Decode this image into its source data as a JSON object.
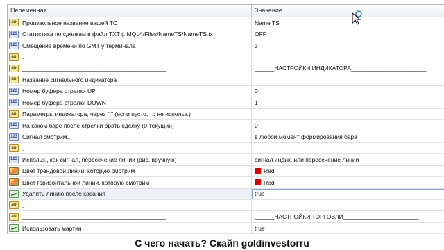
{
  "header": {
    "col_variable": "Переменная",
    "col_value": "Значение"
  },
  "rows": [
    {
      "icon": "ab-string-icon",
      "name": "Произвольное название вашей ТС",
      "value": "Name TS"
    },
    {
      "icon": "number-icon",
      "name": "Статистика по сделкам в файл TXT (..MQL4/Files/NameTS/NameTS.tx",
      "value": "OFF"
    },
    {
      "icon": "number-icon",
      "name": "Смещение времени по GMT у терминала",
      "value": "3"
    },
    {
      "icon": "ab-string-icon",
      "name": ".",
      "value": ""
    },
    {
      "icon": "ab-string-icon",
      "name": "____________________________________________",
      "value": "______НАСТРОЙКИ ИНДИКАТОРА_______________________"
    },
    {
      "icon": "ab-string-icon",
      "name": "Название сигнального индикатора",
      "value": ""
    },
    {
      "icon": "number-icon",
      "name": "Номер буфера стрелки UP",
      "value": "0"
    },
    {
      "icon": "number-icon",
      "name": "Номер буфера стрелки DOWN",
      "value": "1"
    },
    {
      "icon": "ab-string-icon",
      "name": "Параметры индикатора, через \";\" (если пусто, то не использ.)",
      "value": ""
    },
    {
      "icon": "number-icon",
      "name": "На каком баре после стрелки брать сделку (0-текущий)",
      "value": "0"
    },
    {
      "icon": "number-icon",
      "name": "Сигнал смотрим...",
      "value": "в любой момент формирования бара"
    },
    {
      "icon": "ab-string-icon",
      "name": ".",
      "value": ""
    },
    {
      "icon": "number-icon",
      "name": "Использ., как сигнал, пересечение линии (рис. вручную)",
      "value": "сигнал индик. или пересечение линии"
    },
    {
      "icon": "color-icon",
      "name": "Цвет трендовой линии, которую смотрим",
      "value": "Red",
      "swatch": "#e00000"
    },
    {
      "icon": "color-icon",
      "name": "Цвет горизонтальной линии, которую смотрим",
      "value": "Red",
      "swatch": "#e00000"
    },
    {
      "icon": "bool-icon",
      "name": "Удалять линию после касания",
      "value": "true",
      "selected": true
    },
    {
      "icon": "ab-string-icon",
      "name": ".",
      "value": ""
    },
    {
      "icon": "ab-string-icon",
      "name": "____________________________________________",
      "value": "______НАСТРОЙКИ ТОРГОВЛИ_______________________"
    },
    {
      "icon": "bool-icon",
      "name": "Использовать мартин",
      "value": "true"
    }
  ],
  "caption": "С чего начать? Скайп goldinvestorru"
}
